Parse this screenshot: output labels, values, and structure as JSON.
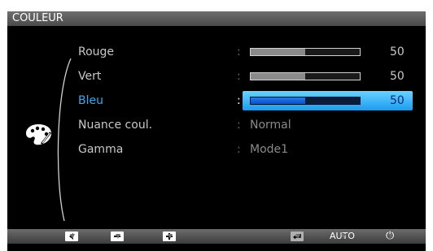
{
  "title": "COULEUR",
  "items": [
    {
      "label": "Rouge",
      "colon": ":",
      "value": "50",
      "level": 0.5
    },
    {
      "label": "Vert",
      "colon": ":",
      "value": "50",
      "level": 0.5
    },
    {
      "label": "Bleu",
      "colon": ":",
      "value": "50",
      "level": 0.5
    },
    {
      "label": "Nuance coul.",
      "colon": ":",
      "value": "Normal"
    },
    {
      "label": "Gamma",
      "colon": ":",
      "value": "Mode1"
    }
  ],
  "selected_item": "Bleu",
  "menu_icon": "color-palette-icon",
  "bottom_bar": {
    "buttons": [
      {
        "icon": "left-arrow-icon"
      },
      {
        "icon": "minus-icon"
      },
      {
        "icon": "plus-icon"
      },
      {
        "icon": "enter-icon"
      }
    ],
    "auto_label": "AUTO",
    "power_icon": "power-icon",
    "power_glyph": "⏻"
  },
  "colors": {
    "background": "#000000",
    "highlight": "#3aa9f0",
    "selected_label": "#3aa9f0",
    "fill_normal": "#8a8a8a",
    "fill_selected": "#1a5fd8"
  }
}
